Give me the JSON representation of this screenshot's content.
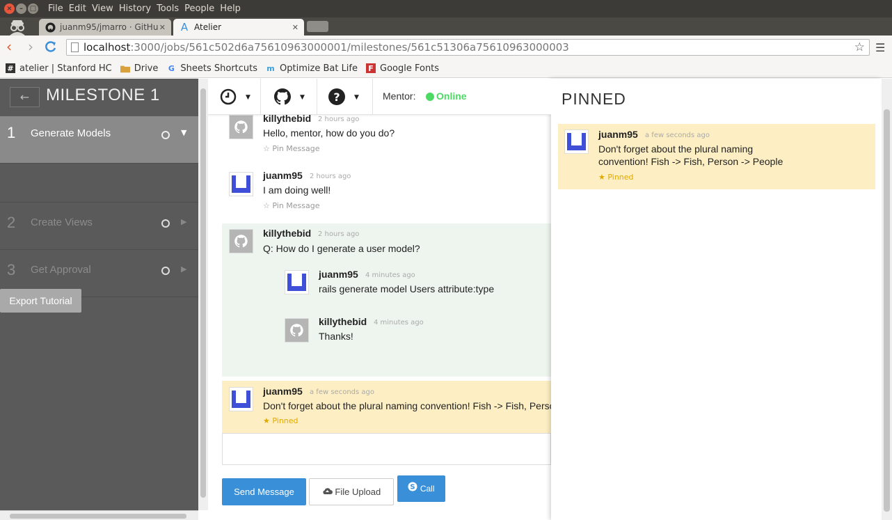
{
  "os_menu": {
    "items": [
      "File",
      "Edit",
      "View",
      "History",
      "Tools",
      "People",
      "Help"
    ]
  },
  "tabs": [
    {
      "title": "juanm95/jmarro · GitHu",
      "active": false
    },
    {
      "title": "Atelier",
      "active": true
    }
  ],
  "address": {
    "host": "localhost",
    "path": ":3000/jobs/561c502d6a75610963000001/milestones/561c51306a75610963000003"
  },
  "bookmarks": [
    {
      "label": "atelier | Stanford HC",
      "icon": "hash-icon"
    },
    {
      "label": "Drive",
      "icon": "folder-icon"
    },
    {
      "label": "Sheets Shortcuts",
      "icon": "google-icon"
    },
    {
      "label": "Optimize Bat Life",
      "icon": "m-icon"
    },
    {
      "label": "Google Fonts",
      "icon": "fonts-icon"
    }
  ],
  "sidebar": {
    "back_label": "←",
    "title": "MILESTONE 1",
    "steps": [
      {
        "num": "1",
        "label": "Generate Models",
        "active": true
      },
      {
        "num": "2",
        "label": "Create Views",
        "active": false
      },
      {
        "num": "3",
        "label": "Get Approval",
        "active": false
      }
    ],
    "export_label": "Export Tutorial"
  },
  "chat_toolbar": {
    "mentor_label": "Mentor:",
    "status": "Online",
    "status_color": "#4cd964"
  },
  "messages": [
    {
      "user": "killythebid",
      "time": "2 hours ago",
      "text": "Hello, mentor, how do you do?",
      "action": "Pin Message"
    },
    {
      "user": "juanm95",
      "time": "2 hours ago",
      "text": "I am doing well!",
      "action": "Pin Message"
    },
    {
      "user": "killythebid",
      "time": "2 hours ago",
      "text": "Q: How do I generate a user model?"
    },
    {
      "user": "juanm95",
      "time": "4 minutes ago",
      "text": "rails generate model Users attribute:type"
    },
    {
      "user": "killythebid",
      "time": "4 minutes ago",
      "text": "Thanks!"
    },
    {
      "user": "juanm95",
      "time": "a few seconds ago",
      "text": "Don't forget about the plural naming convention! Fish -> Fish, Person -> People",
      "status": "Pinned"
    }
  ],
  "composer": {
    "send_label": "Send Message",
    "upload_label": "File Upload",
    "call_label": "Call"
  },
  "pinned_panel": {
    "title": "PINNED",
    "user": "juanm95",
    "time": "a few seconds ago",
    "text_line1": "Don't forget about the plural naming",
    "text_line2": "convention! Fish -> Fish, Person -> People",
    "status": "Pinned"
  },
  "colors": {
    "accent": "#3a8fd9",
    "pinned_bg": "#fdefc3",
    "thread_bg": "#eef5ee",
    "sidebar_bg": "#5a5a5a",
    "user_avatar": "#3f4fd8"
  }
}
